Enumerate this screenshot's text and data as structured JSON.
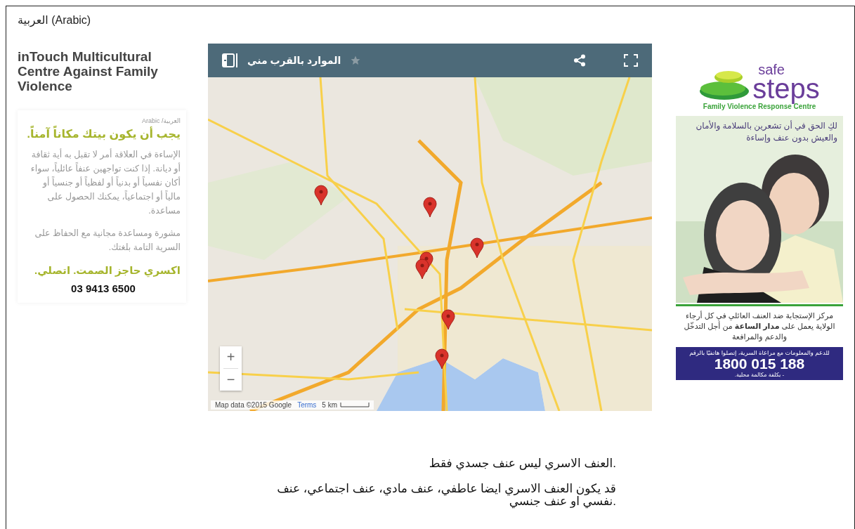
{
  "page_heading": "العربية (Arabic)",
  "organization_name": "inTouch Multicultural Centre Against Family Violence",
  "flyer": {
    "language_tag": "العربية/ Arabic",
    "headline": "يجب أن يكون بيتك مكاناً آمناً.",
    "body": "الإساءة في العلاقة أمر لا تقبل به أية ثقافة أو ديانة. إذا كنت تواجهين عنفاً عائلياً، سواء أكان نفسياً أو بدنياً أو لفظياً أو جنسياً أو مالياً أو اجتماعياً، يمكنك الحصول على مساعدة.",
    "offer": "مشورة ومساعدة مجانية مع الحفاظ على السرية التامة بلغتك.",
    "slogan": "اكسري حاجز الصمت. اتصلي.",
    "phone": "03 9413 6500"
  },
  "map": {
    "title": "الموارد بالقرب مني",
    "starred": false,
    "zoom_in": "+",
    "zoom_out": "−",
    "attribution": "Map data ©2015 Google",
    "terms_link": "Terms",
    "scale": "5 km"
  },
  "ad": {
    "logo_small": "safe",
    "logo_large": "steps",
    "logo_tagline": "Family Violence Response Centre",
    "photo_caption": "لكِ الحق في أن تشعرين بالسلامة والأمان والعيش بدون عنف وإساءة",
    "service_text": "مركز الإستجابة ضد العنف العائلي في كل أرجاء الولاية يعمل على **مدار الساعة** من أجل التدخّل والدعم والمرافعة",
    "hotline_label": "للدعم والمعلومات مع مراعاة السرية، إتصلوا هاتفيًا بالرقم",
    "hotline_number": "1800 015 188",
    "call_cost": "- بكلفة مكالمة محلية."
  },
  "paragraphs": [
    "العنف الاسري ليس عنف جسدي فقط.",
    "قد يكون العنف الاسري ايضا عاطفي، عنف مادي، عنف اجتماعي، عنف نفسي او عنف جنسي."
  ]
}
